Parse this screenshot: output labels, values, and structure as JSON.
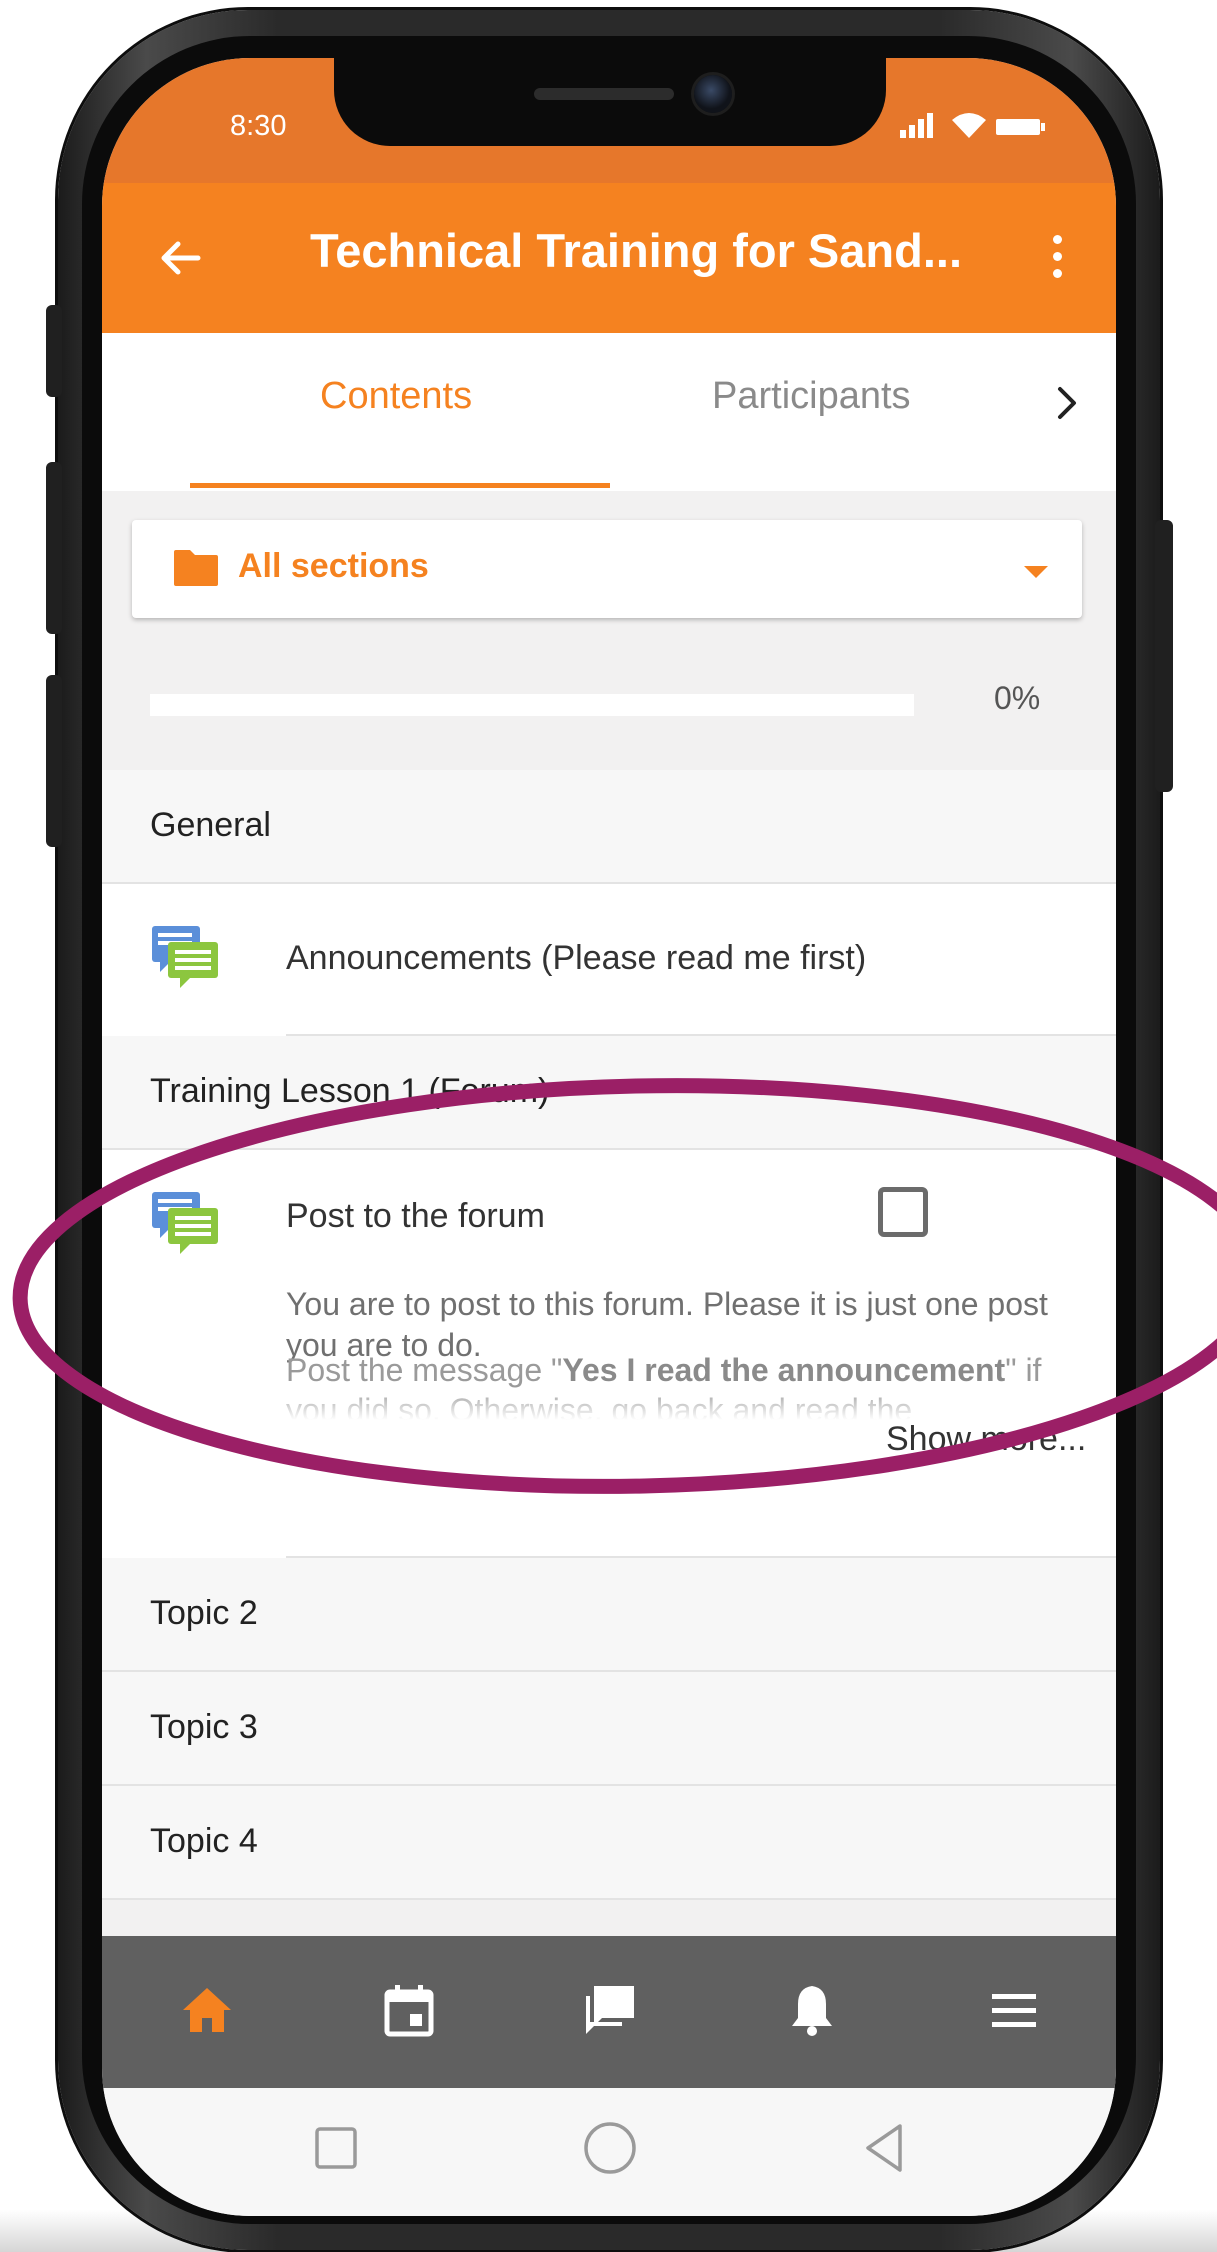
{
  "status_bar": {
    "time": "8:30",
    "icons": [
      "signal-icon",
      "wifi-icon",
      "battery-icon"
    ]
  },
  "app_bar": {
    "title": "Technical Training for Sand...",
    "back_icon": "arrow-left-icon",
    "menu_icon": "more-vertical-icon"
  },
  "tabs": [
    {
      "label": "Contents",
      "active": true
    },
    {
      "label": "Participants",
      "active": false
    }
  ],
  "tab_scroll_icon": "chevron-right-icon",
  "section_selector": {
    "label": "All sections",
    "icon": "folder-icon",
    "dropdown_icon": "caret-down-icon"
  },
  "progress": {
    "value": 0,
    "label": "0%"
  },
  "course": {
    "general": {
      "title": "General",
      "activity": {
        "title": "Announcements (Please read me first)",
        "icon": "forum-icon"
      }
    },
    "lesson1": {
      "title": "Training Lesson 1 (Forum)",
      "activity": {
        "title": "Post to the forum",
        "icon": "forum-icon",
        "completed": false,
        "description_1": "You are to post to this forum. Please it is just one post you are to do.",
        "description_2_prefix": "Post the message \"",
        "description_2_bold": "Yes I read the announcement",
        "description_2_suffix": "\" if you did so. Otherwise, go back and read the",
        "show_more": "Show more..."
      }
    },
    "topics": [
      "Topic 2",
      "Topic 3",
      "Topic 4"
    ]
  },
  "bottom_nav": [
    {
      "icon": "home-icon",
      "active": true
    },
    {
      "icon": "calendar-icon",
      "active": false
    },
    {
      "icon": "messages-icon",
      "active": false
    },
    {
      "icon": "bell-icon",
      "active": false
    },
    {
      "icon": "menu-icon",
      "active": false
    }
  ],
  "system_nav": [
    "recents-button",
    "home-button",
    "back-button"
  ],
  "colors": {
    "accent": "#f58220",
    "status_bar": "#e6772b",
    "bottom_bar": "#606060",
    "highlight": "#9b1f66"
  }
}
